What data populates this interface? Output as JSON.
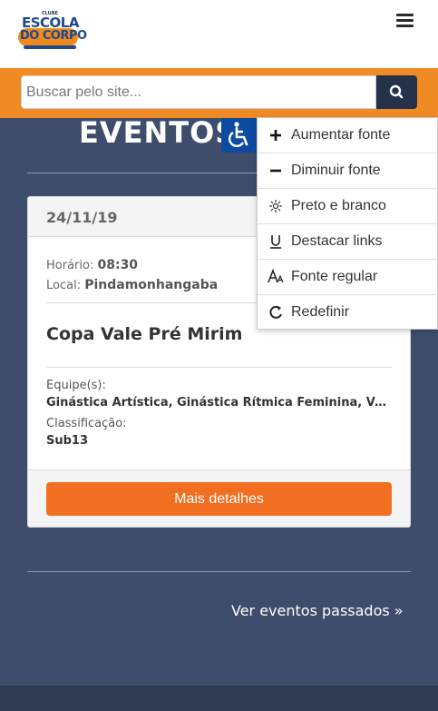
{
  "header": {
    "logo": {
      "top_text": "CLUBE",
      "line1": "ESCOLA",
      "line2": "DO CORPO"
    },
    "menu_icon": "hamburger-icon"
  },
  "search": {
    "placeholder": "Buscar pelo site...",
    "value": "",
    "icon": "search-icon"
  },
  "page": {
    "title": "EVENTOS",
    "accessibility_icon": "wheelchair-icon",
    "past_events_link": "Ver eventos passados »"
  },
  "event_card": {
    "date": "24/11/19",
    "time_label": "Horário:",
    "time_value": "08:30",
    "place_label": "Local:",
    "place_value": "Pindamonhangaba",
    "name": "Copa Vale Pré Mirim",
    "teams_label": "Equipe(s):",
    "teams_value": "Ginástica Artística, Ginástica Rítmica Feminina, Vôlei",
    "classification_label": "Classificação:",
    "classification_value": "Sub13",
    "details_button": "Mais detalhes"
  },
  "accessibility_menu": {
    "items": [
      {
        "label": "Aumentar fonte",
        "icon": "plus-icon"
      },
      {
        "label": "Diminuir fonte",
        "icon": "minus-icon"
      },
      {
        "label": "Preto e branco",
        "icon": "contrast-icon"
      },
      {
        "label": "Destacar links",
        "icon": "underline-icon"
      },
      {
        "label": "Fonte regular",
        "icon": "font-icon"
      },
      {
        "label": "Redefinir",
        "icon": "reset-icon"
      }
    ]
  },
  "colors": {
    "accent_orange": "#f08a24",
    "button_orange": "#f26f21",
    "navy": "#3e4d6b",
    "accessibility_blue": "#0d4ba0"
  }
}
